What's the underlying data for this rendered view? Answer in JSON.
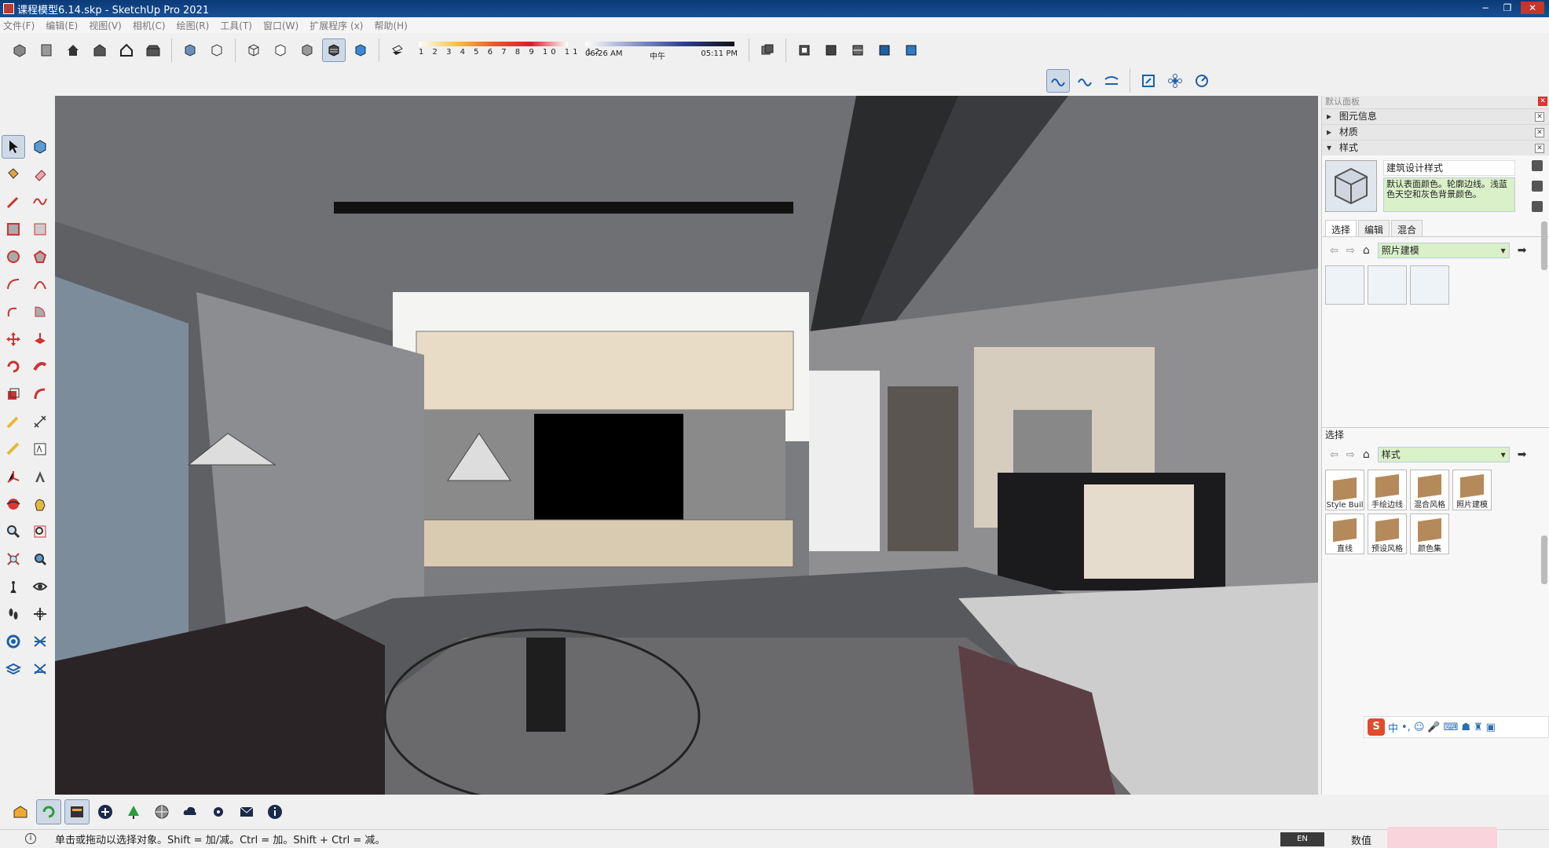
{
  "window": {
    "title": "课程模型6.14.skp - SketchUp Pro 2021"
  },
  "menu": [
    "文件(F)",
    "编辑(E)",
    "视图(V)",
    "相机(C)",
    "绘图(R)",
    "工具(T)",
    "窗口(W)",
    "扩展程序 (x)",
    "帮助(H)"
  ],
  "shadow": {
    "months": "1 2 3 4 5 6 7 8 9 10 11 12",
    "time_start": "06:26 AM",
    "time_mid": "中午",
    "time_end": "05:11 PM"
  },
  "tray": {
    "title": "默认面板",
    "sections": [
      {
        "label": "图元信息",
        "expanded": false
      },
      {
        "label": "材质",
        "expanded": false
      },
      {
        "label": "样式",
        "expanded": true
      }
    ],
    "style_name": "建筑设计样式",
    "style_desc": "默认表面颜色。轮廓边线。浅蓝色天空和灰色背景颜色。",
    "tabs": [
      "选择",
      "编辑",
      "混合"
    ],
    "library_top": "照片建模",
    "select_label": "选择",
    "library_bottom": "样式",
    "styles": [
      "Style Buil",
      "手绘边线",
      "混合风格",
      "照片建模",
      "直线",
      "预设风格",
      "颜色集"
    ]
  },
  "ime": {
    "brand": "S",
    "mode": "中"
  },
  "status": {
    "message": "单击或拖动以选择对象。Shift = 加/减。Ctrl = 加。Shift + Ctrl = 减。",
    "lang": "EN",
    "vcb_label": "数值"
  },
  "colors": {
    "accent": "#3b6cb5",
    "highlight": "#cfd9e6"
  }
}
